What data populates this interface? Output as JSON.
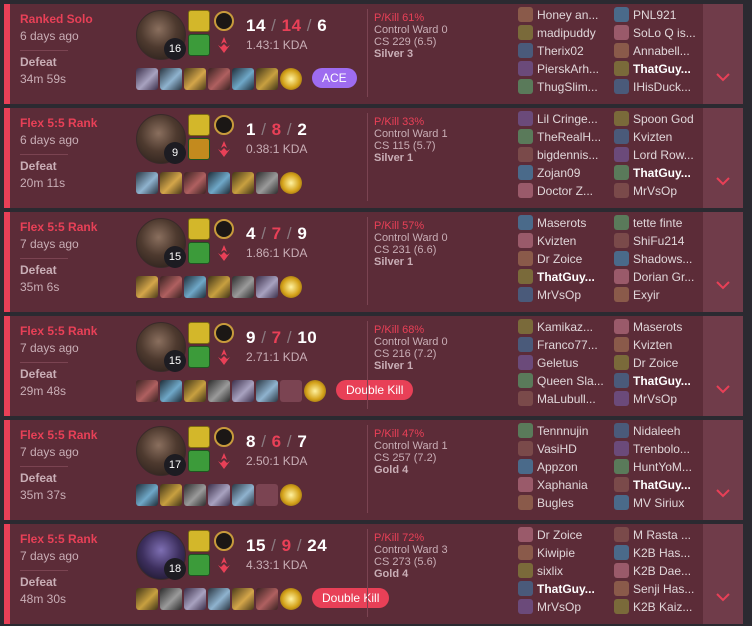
{
  "me": "ThatGuy...",
  "matches": [
    {
      "queue": "Ranked Solo",
      "ago": "6 days ago",
      "result": "Defeat",
      "length": "34m 59s",
      "champion": "Braum-like champion portrait",
      "level": "16",
      "kills": "14",
      "deaths": "14",
      "assists": "6",
      "kda": "1.43:1 KDA",
      "pkill": "P/Kill 61%",
      "control_ward": "Control Ward 0",
      "cs": "CS 229 (6.5)",
      "tier": "Silver 3",
      "badge": "ACE",
      "badge_color": "#9e6cf0",
      "team1": [
        "Honey an...",
        "madipuddy",
        "Therix02",
        "PierskArh...",
        "ThugSlim..."
      ],
      "team2": [
        "PNL921",
        "SoLo Q is...",
        "Annabell...",
        "ThatGuy...",
        "IHisDuck..."
      ]
    },
    {
      "queue": "Flex 5:5 Rank",
      "ago": "6 days ago",
      "result": "Defeat",
      "length": "20m 11s",
      "champion": "Draven-like champion portrait",
      "level": "9",
      "kills": "1",
      "deaths": "8",
      "assists": "2",
      "kda": "0.38:1 KDA",
      "pkill": "P/Kill 33%",
      "control_ward": "Control Ward 1",
      "cs": "CS 115 (5.7)",
      "tier": "Silver 1",
      "badge": "",
      "badge_color": "",
      "team1": [
        "Lil Cringe...",
        "TheRealH...",
        "bigdennis...",
        "Zojan09",
        "Doctor Z..."
      ],
      "team2": [
        "Spoon God",
        "Kvizten",
        "Lord Row...",
        "ThatGuy...",
        "MrVsOp"
      ]
    },
    {
      "queue": "Flex 5:5 Rank",
      "ago": "7 days ago",
      "result": "Defeat",
      "length": "35m 6s",
      "champion": "Draven-like champion portrait",
      "level": "15",
      "kills": "4",
      "deaths": "7",
      "assists": "9",
      "kda": "1.86:1 KDA",
      "pkill": "P/Kill 57%",
      "control_ward": "Control Ward 0",
      "cs": "CS 231 (6.6)",
      "tier": "Silver 1",
      "badge": "",
      "badge_color": "",
      "team1": [
        "Maserots",
        "Kvizten",
        "Dr Zoice",
        "ThatGuy...",
        "MrVsOp"
      ],
      "team2": [
        "tette finte",
        "ShiFu214",
        "Shadows...",
        "Dorian Gr...",
        "Exyir"
      ]
    },
    {
      "queue": "Flex 5:5 Rank",
      "ago": "7 days ago",
      "result": "Defeat",
      "length": "29m 48s",
      "champion": "Draven-like champion portrait",
      "level": "15",
      "kills": "9",
      "deaths": "7",
      "assists": "10",
      "kda": "2.71:1 KDA",
      "pkill": "P/Kill 68%",
      "control_ward": "Control Ward 0",
      "cs": "CS 216 (7.2)",
      "tier": "Silver 1",
      "badge": "Double Kill",
      "badge_color": "#e84057",
      "team1": [
        "Kamikaz...",
        "Franco77...",
        "Geletus",
        "Queen Sla...",
        "MaLubull..."
      ],
      "team2": [
        "Maserots",
        "Kvizten",
        "Dr Zoice",
        "ThatGuy...",
        "MrVsOp"
      ]
    },
    {
      "queue": "Flex 5:5 Rank",
      "ago": "7 days ago",
      "result": "Defeat",
      "length": "35m 37s",
      "champion": "Draven-like champion portrait",
      "level": "17",
      "kills": "8",
      "deaths": "6",
      "assists": "7",
      "kda": "2.50:1 KDA",
      "pkill": "P/Kill 47%",
      "control_ward": "Control Ward 1",
      "cs": "CS 257 (7.2)",
      "tier": "Gold 4",
      "badge": "",
      "badge_color": "",
      "team1": [
        "Tennnujin",
        "VasiHD",
        "Appzon",
        "Xaphania",
        "Bugles"
      ],
      "team2": [
        "Nidaleeh",
        "Trenbolo...",
        "HuntYoM...",
        "ThatGuy...",
        "MV Siriux"
      ]
    },
    {
      "queue": "Flex 5:5 Rank",
      "ago": "7 days ago",
      "result": "Defeat",
      "length": "48m 30s",
      "champion": "Fiora-like champion portrait",
      "level": "18",
      "kills": "15",
      "deaths": "9",
      "assists": "24",
      "kda": "4.33:1 KDA",
      "pkill": "P/Kill 72%",
      "control_ward": "Control Ward 3",
      "cs": "CS 273 (5.6)",
      "tier": "Gold 4",
      "badge": "Double Kill",
      "badge_color": "#e84057",
      "team1": [
        "Dr Zoice",
        "Kiwipie",
        "sixlix",
        "ThatGuy...",
        "MrVsOp"
      ],
      "team2": [
        "M Rasta ...",
        "K2B Has...",
        "K2B Dae...",
        "Senji Has...",
        "K2B Kaiz..."
      ]
    }
  ],
  "colors": {
    "loss_accent": "#e84057",
    "card_bg": "#5c2c38",
    "expand_bg": "#703c4a",
    "ace_badge": "#9e6cf0",
    "double_kill_badge": "#e84057"
  },
  "icons": {
    "expand": "chevron-down-icon",
    "summoner_spell_1": "flash-spell-icon",
    "summoner_spell_2": "ghost-or-heal-spell-icon",
    "keystone": "keystone-rune-icon",
    "secondary": "secondary-rune-tree-icon"
  }
}
